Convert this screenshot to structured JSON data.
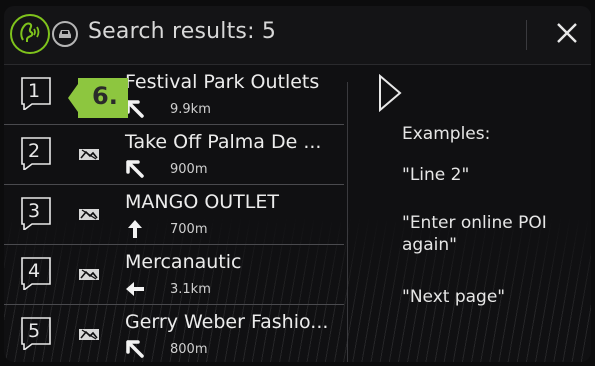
{
  "header": {
    "title": "Search results: 5"
  },
  "badge": {
    "label": "6."
  },
  "results": [
    {
      "number": "1",
      "name": "Festival Park Outlets",
      "distance": "9.9km",
      "direction": "up-left"
    },
    {
      "number": "2",
      "name": "Take Off Palma De ...",
      "distance": "900m",
      "direction": "up-left"
    },
    {
      "number": "3",
      "name": "MANGO OUTLET",
      "distance": "700m",
      "direction": "up"
    },
    {
      "number": "4",
      "name": "Mercanautic",
      "distance": "3.1km",
      "direction": "left"
    },
    {
      "number": "5",
      "name": "Gerry Weber Fashio...",
      "distance": "800m",
      "direction": "up-left"
    }
  ],
  "examples": {
    "title": "Examples:",
    "items": [
      "\"Line 2\"",
      "\"Enter online POI again\"",
      "\"Next page\""
    ]
  },
  "colors": {
    "accent": "#7fc31c",
    "badge_bg": "#8dc63f",
    "text": "#e8e8e8",
    "background": "#101012"
  },
  "icons": [
    "voice-control-icon",
    "car-icon",
    "close-icon",
    "speech-bubble-icon",
    "poi-category-icon",
    "direction-arrow-icon",
    "play-icon"
  ]
}
